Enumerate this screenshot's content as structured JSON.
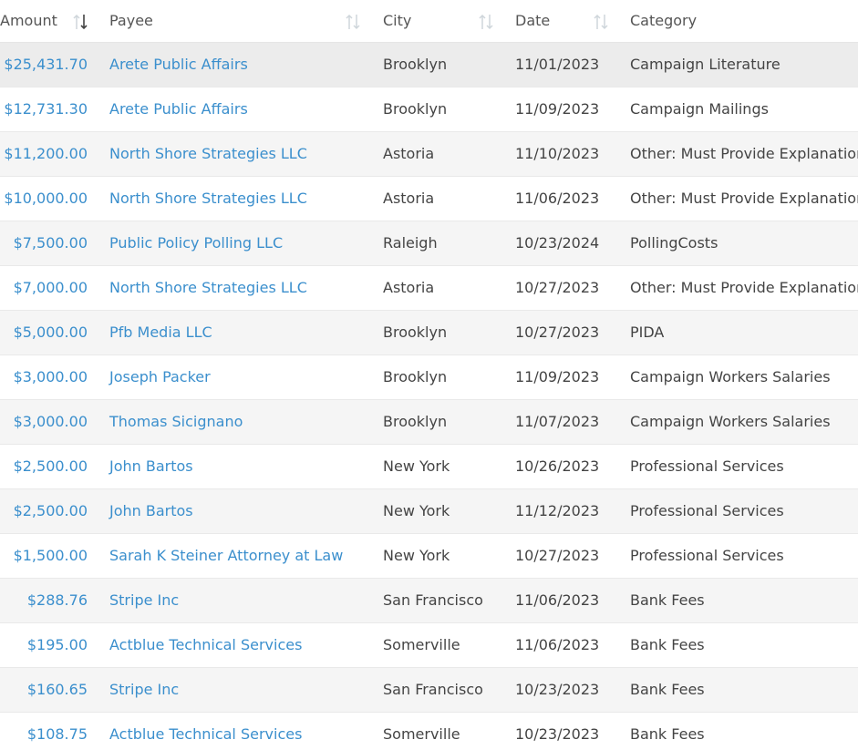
{
  "header": {
    "amount": "Amount",
    "payee": "Payee",
    "city": "City",
    "date": "Date",
    "category": "Category"
  },
  "colors": {
    "link": "#3b8fcd",
    "text": "#444444",
    "stripe": "#f5f5f5",
    "highlight": "#ececec"
  },
  "rows": [
    {
      "amount": "$25,431.70",
      "payee": "Arete Public Affairs",
      "city": "Brooklyn",
      "date": "11/01/2023",
      "category": "Campaign Literature"
    },
    {
      "amount": "$12,731.30",
      "payee": "Arete Public Affairs",
      "city": "Brooklyn",
      "date": "11/09/2023",
      "category": "Campaign Mailings"
    },
    {
      "amount": "$11,200.00",
      "payee": "North Shore Strategies LLC",
      "city": "Astoria",
      "date": "11/10/2023",
      "category": "Other: Must Provide Explanation"
    },
    {
      "amount": "$10,000.00",
      "payee": "North Shore Strategies LLC",
      "city": "Astoria",
      "date": "11/06/2023",
      "category": "Other: Must Provide Explanation"
    },
    {
      "amount": "$7,500.00",
      "payee": "Public Policy Polling LLC",
      "city": "Raleigh",
      "date": "10/23/2024",
      "category": "PollingCosts"
    },
    {
      "amount": "$7,000.00",
      "payee": "North Shore Strategies LLC",
      "city": "Astoria",
      "date": "10/27/2023",
      "category": "Other: Must Provide Explanation"
    },
    {
      "amount": "$5,000.00",
      "payee": "Pfb Media LLC",
      "city": "Brooklyn",
      "date": "10/27/2023",
      "category": "PIDA"
    },
    {
      "amount": "$3,000.00",
      "payee": "Joseph Packer",
      "city": "Brooklyn",
      "date": "11/09/2023",
      "category": "Campaign Workers Salaries"
    },
    {
      "amount": "$3,000.00",
      "payee": "Thomas Sicignano",
      "city": "Brooklyn",
      "date": "11/07/2023",
      "category": "Campaign Workers Salaries"
    },
    {
      "amount": "$2,500.00",
      "payee": "John Bartos",
      "city": "New York",
      "date": "10/26/2023",
      "category": "Professional Services"
    },
    {
      "amount": "$2,500.00",
      "payee": "John Bartos",
      "city": "New York",
      "date": "11/12/2023",
      "category": "Professional Services"
    },
    {
      "amount": "$1,500.00",
      "payee": "Sarah K Steiner Attorney at Law",
      "city": "New York",
      "date": "10/27/2023",
      "category": "Professional Services"
    },
    {
      "amount": "$288.76",
      "payee": "Stripe Inc",
      "city": "San Francisco",
      "date": "11/06/2023",
      "category": "Bank Fees"
    },
    {
      "amount": "$195.00",
      "payee": "Actblue Technical Services",
      "city": "Somerville",
      "date": "11/06/2023",
      "category": "Bank Fees"
    },
    {
      "amount": "$160.65",
      "payee": "Stripe Inc",
      "city": "San Francisco",
      "date": "10/23/2023",
      "category": "Bank Fees"
    },
    {
      "amount": "$108.75",
      "payee": "Actblue Technical Services",
      "city": "Somerville",
      "date": "10/23/2023",
      "category": "Bank Fees"
    }
  ]
}
